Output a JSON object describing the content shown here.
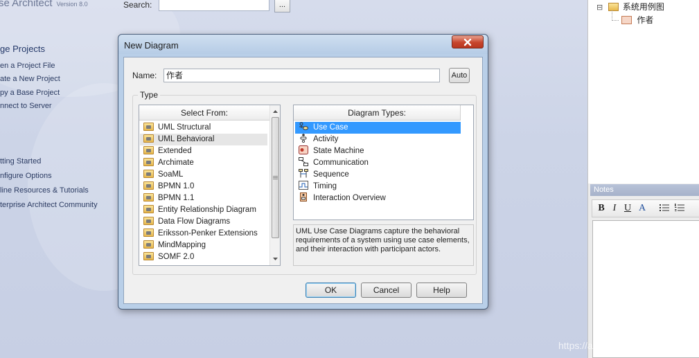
{
  "start_page": {
    "app_title": "se Architect",
    "app_version": "Version 8.0",
    "search_label": "Search:",
    "search_value": "",
    "search_button": "...",
    "projects_heading": "ge Projects",
    "project_links": [
      "en a Project File",
      "ate a New Project",
      "py a Base Project",
      "nnect to Server"
    ],
    "resource_links": [
      "tting Started",
      "nfigure Options",
      "line Resources & Tutorials",
      "terprise Architect Community"
    ]
  },
  "tree": {
    "expander": "⊟",
    "root_label": "系统用例图",
    "child_label": "作者"
  },
  "notes": {
    "title": "Notes",
    "toolbar": [
      "B",
      "I",
      "U",
      "A"
    ]
  },
  "dialog": {
    "title": "New Diagram",
    "close_label": "x",
    "name_label": "Name:",
    "name_value": "作者",
    "auto_button": "Auto",
    "type_group_label": "Type",
    "select_from_header": "Select From:",
    "select_from_items": [
      "UML Structural",
      "UML Behavioral",
      "Extended",
      "Archimate",
      "SoaML",
      "BPMN 1.0",
      "BPMN 1.1",
      "Entity Relationship Diagram",
      "Data Flow Diagrams",
      "Eriksson-Penker Extensions",
      "MindMapping",
      "SOMF 2.0"
    ],
    "selected_from": "UML Behavioral",
    "diagram_types_header": "Diagram Types:",
    "diagram_types": [
      {
        "label": "Use Case",
        "icon": "use-case-icon"
      },
      {
        "label": "Activity",
        "icon": "activity-icon"
      },
      {
        "label": "State Machine",
        "icon": "state-machine-icon"
      },
      {
        "label": "Communication",
        "icon": "communication-icon"
      },
      {
        "label": "Sequence",
        "icon": "sequence-icon"
      },
      {
        "label": "Timing",
        "icon": "timing-icon"
      },
      {
        "label": "Interaction Overview",
        "icon": "interaction-overview-icon"
      }
    ],
    "selected_type": "Use Case",
    "description": "UML Use Case Diagrams capture the behavioral requirements of a system using use case elements, and their interaction with participant actors.",
    "ok_button": "OK",
    "cancel_button": "Cancel",
    "help_button": "Help"
  },
  "watermark": "https://aaeedu@51CTO博客",
  "colors": {
    "selection": "#3399ff",
    "dialog_frame": "#b9cfe8",
    "close_button": "#c7452c"
  }
}
